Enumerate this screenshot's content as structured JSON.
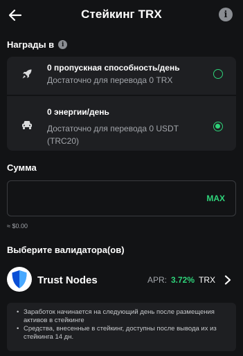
{
  "header": {
    "title": "Стейкинг TRX",
    "back_icon": "arrow-left-icon",
    "info_icon": "info-icon",
    "info_glyph": "i"
  },
  "rewards": {
    "label": "Награды в",
    "info_glyph": "i",
    "options": [
      {
        "icon": "rocket-icon",
        "title": "0 пропускная способность/день",
        "subtitle": "Достаточно для перевода 0 TRX",
        "selected": false
      },
      {
        "icon": "car-icon",
        "title": "0 энергии/день",
        "subtitle": "Достаточно для перевода 0 USDT (TRC20)",
        "selected": true
      }
    ]
  },
  "amount": {
    "label": "Сумма",
    "value": "",
    "placeholder": "",
    "max_label": "MAX",
    "usd_value": "≈ $0.00"
  },
  "validator": {
    "label": "Выберите валидатора(ов)",
    "name": "Trust Nodes",
    "logo_icon": "shield-icon",
    "apr_label": "APR:",
    "apr_value": "3.72%",
    "apr_unit": "TRX",
    "chevron_icon": "chevron-right-icon"
  },
  "notes": [
    "Заработок начинается на следующий день после размещения активов в стейкинге",
    "Средства, внесенные в стейкинг, доступны после вывода их из стейкинга 14 дн."
  ],
  "colors": {
    "background": "#121315",
    "card": "#1e1f22",
    "accent": "#2ed47a",
    "muted_text": "#a3a6ab"
  }
}
